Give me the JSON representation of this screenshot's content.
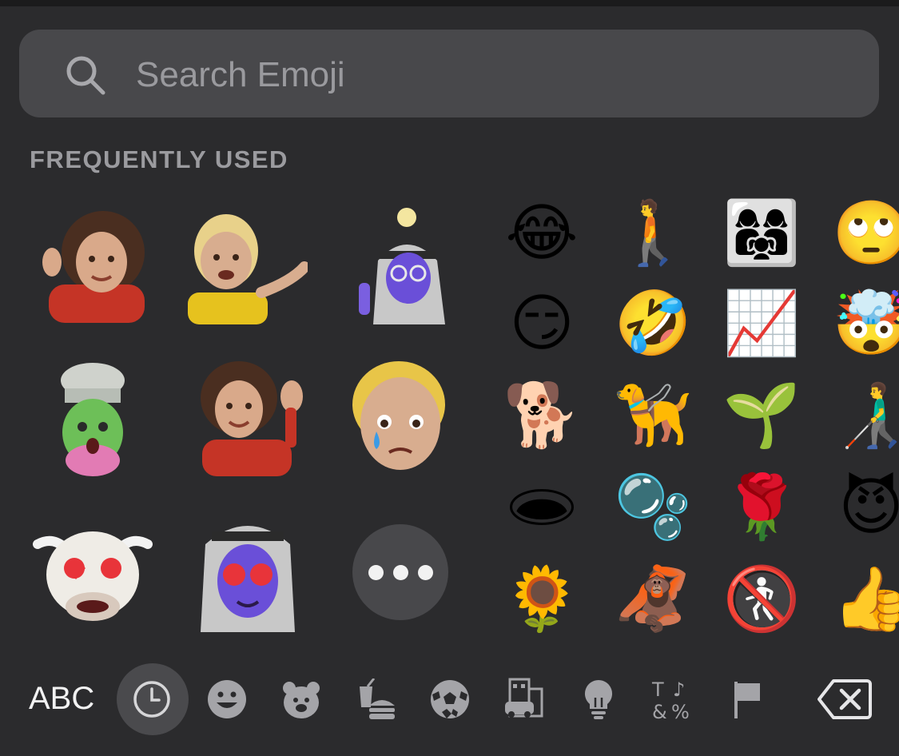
{
  "search": {
    "placeholder": "Search Emoji",
    "icon": "search-icon"
  },
  "section": {
    "title": "FREQUENTLY USED"
  },
  "memoji": [
    {
      "name": "memoji-call-me-curly-hair"
    },
    {
      "name": "memoji-shrug-blond"
    },
    {
      "name": "memoji-idea-keffiyeh"
    },
    {
      "name": "memoji-mind-blown-green"
    },
    {
      "name": "memoji-wave-curly-hair"
    },
    {
      "name": "memoji-crying-blond"
    },
    {
      "name": "memoji-cow-heart-eyes"
    },
    {
      "name": "memoji-heart-eyes-keffiyeh"
    }
  ],
  "emoji_rows": [
    [
      "😂",
      "🚶",
      "👩‍👩‍👧",
      "🙄"
    ],
    [
      "😏",
      "🤣",
      "📈",
      "🤯"
    ],
    [
      "🐕",
      "🦮",
      "🌱",
      "👨‍🦯"
    ],
    [
      "🕳",
      "🫧",
      "🌹",
      "😈"
    ],
    [
      "🌻",
      "🦧",
      "🚷",
      "👍"
    ]
  ],
  "more_button": {
    "name": "more-memoji"
  },
  "toolbar": {
    "abc_label": "ABC",
    "categories": [
      "recent-clock-icon",
      "smileys-icon",
      "animals-icon",
      "food-icon",
      "activity-icon",
      "travel-icon",
      "objects-icon",
      "symbols-icon",
      "flags-icon"
    ],
    "active": "recent-clock-icon",
    "delete": "delete-icon"
  },
  "colors": {
    "background": "#2b2b2d",
    "search_bg": "#48484b",
    "text_muted": "#9b9b9f",
    "icon": "#bdbdc0"
  }
}
